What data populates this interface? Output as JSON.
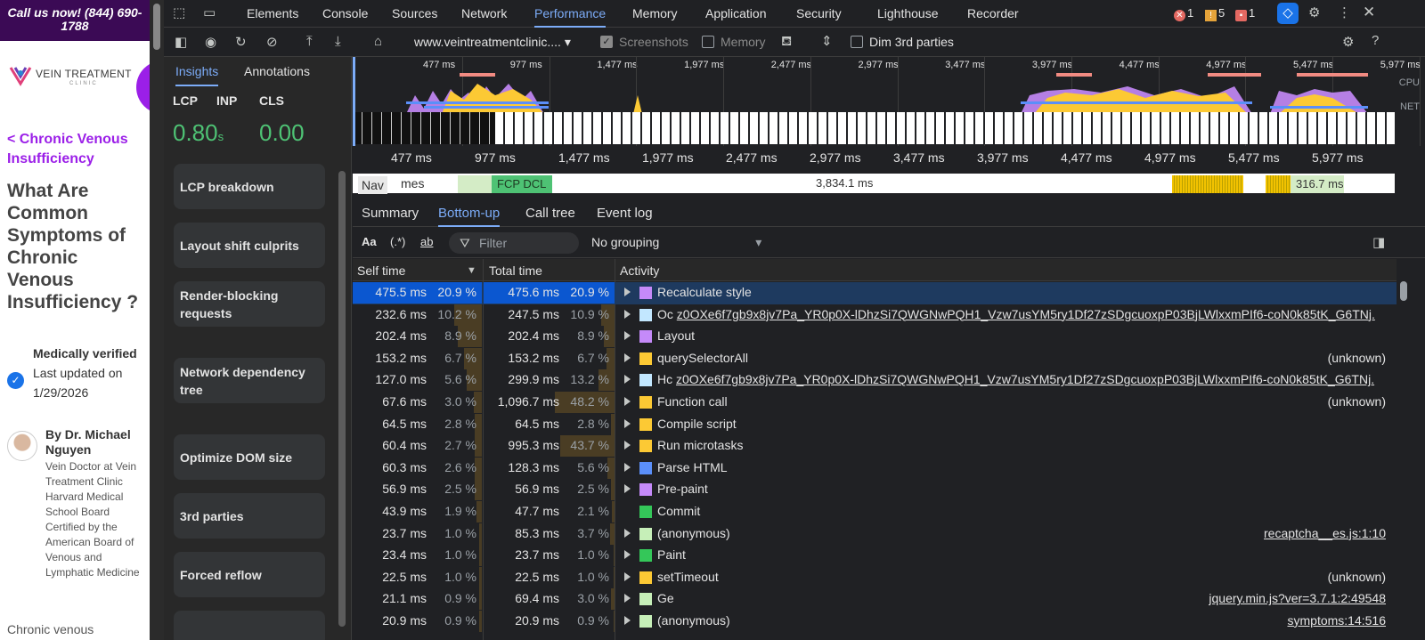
{
  "site": {
    "call_bar": "Call us now! (844) 690-1788",
    "logo_text": "VEIN TREATMENT",
    "logo_sub": "CLINIC",
    "back_link": "< Chronic Venous Insufficiency",
    "heading": "What Are Common Symptoms of Chronic Venous Insufficiency ?",
    "verified_label": "Medically verified",
    "updated_label": "Last updated on 1/29/2026",
    "author_name": "By Dr. Michael Nguyen",
    "author_bio": "Vein Doctor at Vein Treatment Clinic Harvard Medical School Board Certified by the American Board of Venous and Lymphatic Medicine",
    "cut_text": "Chronic venous"
  },
  "devtools": {
    "tabs": [
      "Elements",
      "Console",
      "Sources",
      "Network",
      "Performance",
      "Memory",
      "Application",
      "Security",
      "Lighthouse",
      "Recorder"
    ],
    "active_tab": "Performance",
    "counters": {
      "errors": "1",
      "warnings": "5",
      "issues": "1"
    },
    "toolbar": {
      "url": "www.veintreatmentclinic....",
      "screenshots_label": "Screenshots",
      "screenshots_checked": true,
      "memory_label": "Memory",
      "memory_checked": false,
      "dim_label": "Dim 3rd parties",
      "dim_checked": false
    },
    "insights": {
      "tabs": [
        "Insights",
        "Annotations"
      ],
      "metrics": [
        {
          "label": "LCP",
          "value": "0.80",
          "suffix": "s"
        },
        {
          "label": "INP",
          "value": "",
          "suffix": ""
        },
        {
          "label": "CLS",
          "value": "0.00",
          "suffix": ""
        }
      ],
      "cards": [
        "LCP breakdown",
        "Layout shift culprits",
        "Render-blocking requests",
        "Network dependency tree",
        "Optimize DOM size",
        "3rd parties",
        "Forced reflow"
      ]
    },
    "timeline": {
      "overview_ticks": [
        "477 ms",
        "977 ms",
        "1,477 ms",
        "1,977 ms",
        "2,477 ms",
        "2,977 ms",
        "3,477 ms",
        "3,977 ms",
        "4,477 ms",
        "4,977 ms",
        "5,477 ms",
        "5,977 ms"
      ],
      "cpu_label": "CPU",
      "net_label": "NET",
      "nav_label": "Nav",
      "frames_label": "mes",
      "fcp_label": "FCP",
      "dcl_label": "DCL",
      "frame_mid": "3,834.1 ms",
      "frame_end": "316.7 ms"
    },
    "bottom_tabs": [
      "Summary",
      "Bottom-up",
      "Call tree",
      "Event log"
    ],
    "active_bottom_tab": "Bottom-up",
    "filter": {
      "case_label": "Aa",
      "regex_label": "(.*)",
      "whole_word_label": "ab",
      "placeholder": "Filter",
      "grouping": "No grouping"
    },
    "table": {
      "headers": {
        "self": "Self time",
        "total": "Total time",
        "activity": "Activity"
      },
      "rows": [
        {
          "self": "475.5 ms",
          "self_pct": "20.9 %",
          "total": "475.6 ms",
          "total_pct": "20.9 %",
          "expand": true,
          "color": "#c58af9",
          "name": "Recalculate style",
          "url": "",
          "right": "",
          "right_link": false,
          "self_frac": 0.209,
          "total_frac": 0.209
        },
        {
          "self": "232.6 ms",
          "self_pct": "10.2 %",
          "total": "247.5 ms",
          "total_pct": "10.9 %",
          "expand": true,
          "color": "#c2e7ff",
          "name": "Oc",
          "url": "z0OXe6f7gb9x8jv7Pa_YR0p0X-lDhzSi7QWGNwPQH1_Vzw7usYM5ry1Df27zSDgcuoxpP03BjLWlxxmPIf6-coN0k85tK_G6TNj.",
          "right": "",
          "right_link": false,
          "self_frac": 0.102,
          "total_frac": 0.109
        },
        {
          "self": "202.4 ms",
          "self_pct": "8.9 %",
          "total": "202.4 ms",
          "total_pct": "8.9 %",
          "expand": true,
          "color": "#c58af9",
          "name": "Layout",
          "url": "",
          "right": "",
          "right_link": false,
          "self_frac": 0.089,
          "total_frac": 0.089
        },
        {
          "self": "153.2 ms",
          "self_pct": "6.7 %",
          "total": "153.2 ms",
          "total_pct": "6.7 %",
          "expand": true,
          "color": "#fcc934",
          "name": "querySelectorAll",
          "url": "",
          "right": "(unknown)",
          "right_link": false,
          "self_frac": 0.067,
          "total_frac": 0.067
        },
        {
          "self": "127.0 ms",
          "self_pct": "5.6 %",
          "total": "299.9 ms",
          "total_pct": "13.2 %",
          "expand": true,
          "color": "#c2e7ff",
          "name": "Hc",
          "url": "z0OXe6f7gb9x8jv7Pa_YR0p0X-lDhzSi7QWGNwPQH1_Vzw7usYM5ry1Df27zSDgcuoxpP03BjLWlxxmPIf6-coN0k85tK_G6TNj.",
          "right": "",
          "right_link": false,
          "self_frac": 0.056,
          "total_frac": 0.132
        },
        {
          "self": "67.6 ms",
          "self_pct": "3.0 %",
          "total": "1,096.7 ms",
          "total_pct": "48.2 %",
          "expand": true,
          "color": "#fcc934",
          "name": "Function call",
          "url": "",
          "right": "(unknown)",
          "right_link": false,
          "self_frac": 0.03,
          "total_frac": 0.482
        },
        {
          "self": "64.5 ms",
          "self_pct": "2.8 %",
          "total": "64.5 ms",
          "total_pct": "2.8 %",
          "expand": true,
          "color": "#fcc934",
          "name": "Compile script",
          "url": "",
          "right": "",
          "right_link": false,
          "self_frac": 0.028,
          "total_frac": 0.028
        },
        {
          "self": "60.4 ms",
          "self_pct": "2.7 %",
          "total": "995.3 ms",
          "total_pct": "43.7 %",
          "expand": true,
          "color": "#fcc934",
          "name": "Run microtasks",
          "url": "",
          "right": "",
          "right_link": false,
          "self_frac": 0.027,
          "total_frac": 0.437
        },
        {
          "self": "60.3 ms",
          "self_pct": "2.6 %",
          "total": "128.3 ms",
          "total_pct": "5.6 %",
          "expand": true,
          "color": "#5b8ff9",
          "name": "Parse HTML",
          "url": "",
          "right": "",
          "right_link": false,
          "self_frac": 0.026,
          "total_frac": 0.056
        },
        {
          "self": "56.9 ms",
          "self_pct": "2.5 %",
          "total": "56.9 ms",
          "total_pct": "2.5 %",
          "expand": true,
          "color": "#c58af9",
          "name": "Pre-paint",
          "url": "",
          "right": "",
          "right_link": false,
          "self_frac": 0.025,
          "total_frac": 0.025
        },
        {
          "self": "43.9 ms",
          "self_pct": "1.9 %",
          "total": "47.7 ms",
          "total_pct": "2.1 %",
          "expand": false,
          "color": "#34c759",
          "name": "Commit",
          "url": "",
          "right": "",
          "right_link": false,
          "self_frac": 0.019,
          "total_frac": 0.021
        },
        {
          "self": "23.7 ms",
          "self_pct": "1.0 %",
          "total": "85.3 ms",
          "total_pct": "3.7 %",
          "expand": true,
          "color": "#c6efb8",
          "name": "(anonymous)",
          "url": "",
          "right": "recaptcha__es.js:1:10",
          "right_link": true,
          "self_frac": 0.01,
          "total_frac": 0.037
        },
        {
          "self": "23.4 ms",
          "self_pct": "1.0 %",
          "total": "23.7 ms",
          "total_pct": "1.0 %",
          "expand": true,
          "color": "#34c759",
          "name": "Paint",
          "url": "",
          "right": "",
          "right_link": false,
          "self_frac": 0.01,
          "total_frac": 0.01
        },
        {
          "self": "22.5 ms",
          "self_pct": "1.0 %",
          "total": "22.5 ms",
          "total_pct": "1.0 %",
          "expand": true,
          "color": "#fcc934",
          "name": "setTimeout",
          "url": "",
          "right": "(unknown)",
          "right_link": false,
          "self_frac": 0.01,
          "total_frac": 0.01
        },
        {
          "self": "21.1 ms",
          "self_pct": "0.9 %",
          "total": "69.4 ms",
          "total_pct": "3.0 %",
          "expand": true,
          "color": "#c6efb8",
          "name": "Ge",
          "url": "",
          "right": "jquery.min.js?ver=3.7.1:2:49548",
          "right_link": true,
          "self_frac": 0.009,
          "total_frac": 0.03
        },
        {
          "self": "20.9 ms",
          "self_pct": "0.9 %",
          "total": "20.9 ms",
          "total_pct": "0.9 %",
          "expand": true,
          "color": "#c6efb8",
          "name": "(anonymous)",
          "url": "",
          "right": "symptoms:14:516",
          "right_link": true,
          "self_frac": 0.009,
          "total_frac": 0.009
        }
      ]
    }
  }
}
